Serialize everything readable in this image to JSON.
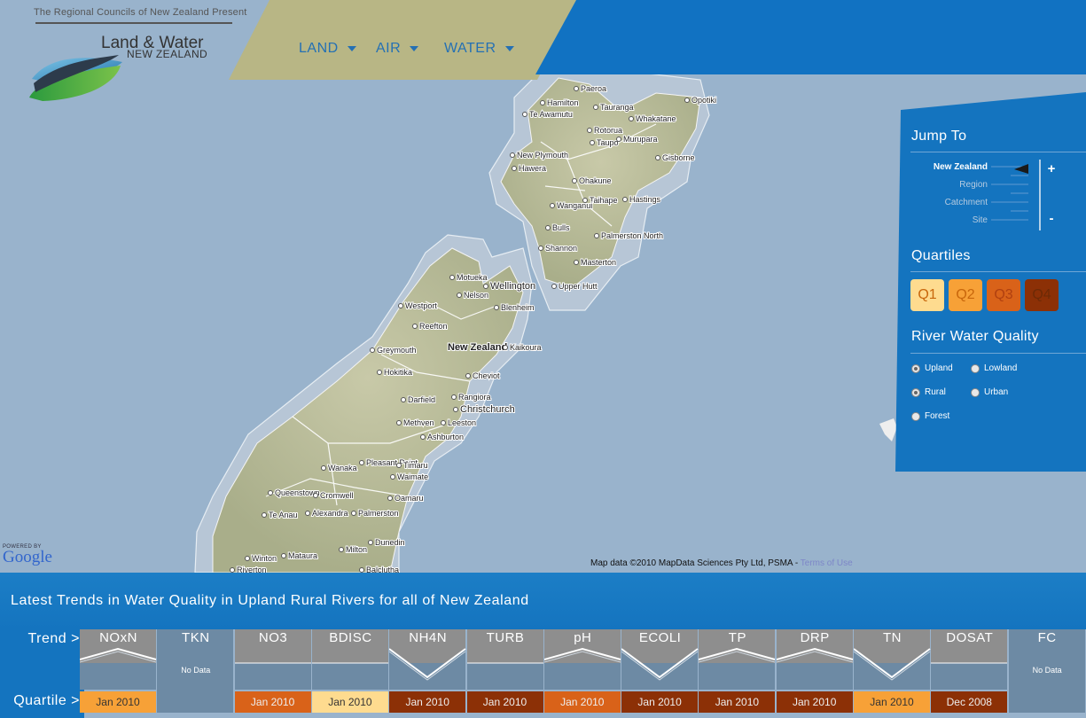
{
  "header": {
    "presenter": "The Regional Councils of New Zealand Present",
    "logo_line1": "Land & Water",
    "logo_line2": "NEW ZEALAND"
  },
  "nav": [
    {
      "label": "LAND"
    },
    {
      "label": "AIR"
    },
    {
      "label": "WATER"
    }
  ],
  "map": {
    "places": [
      "Paeroa",
      "Hamilton",
      "Te Awamutu",
      "Tauranga",
      "Whakatane",
      "Opotiki",
      "Rotorua",
      "Taupo",
      "Murupara",
      "Gisborne",
      "New Plymouth",
      "Hawera",
      "Ohakune",
      "Taihape",
      "Hastings",
      "Wanganui",
      "Bulls",
      "Palmerston North",
      "Shannon",
      "Masterton",
      "Upper Hutt",
      "Wellington",
      "Motueka",
      "Nelson",
      "Blenheim",
      "Westport",
      "Reefton",
      "New Zealand",
      "Kaikoura",
      "Greymouth",
      "Hokitika",
      "Cheviot",
      "Rangiora",
      "Darfield",
      "Christchurch",
      "Methven",
      "Leeston",
      "Ashburton",
      "Wanaka",
      "Pleasant Point",
      "Timaru",
      "Waimate",
      "Queenstown",
      "Cromwell",
      "Te Anau",
      "Alexandra",
      "Oamaru",
      "Palmerston",
      "Dunedin",
      "Winton",
      "Mataura",
      "Milton",
      "Riverton",
      "Balclutha"
    ],
    "powered_by": "POWERED BY",
    "google": "Google",
    "attribution": "Map data ©2010  MapData Sciences Pty Ltd, PSMA - ",
    "terms": "Terms of Use"
  },
  "jump_to": {
    "title": "Jump To",
    "levels": [
      "New Zealand",
      "Region",
      "Catchment",
      "Site"
    ],
    "zoom_in": "+",
    "zoom_out": "-"
  },
  "quartiles": {
    "title": "Quartiles",
    "items": [
      {
        "label": "Q1",
        "color": "#fedb8f",
        "text": "#c8660b"
      },
      {
        "label": "Q2",
        "color": "#f7a137",
        "text": "#c8660b"
      },
      {
        "label": "Q3",
        "color": "#d96219",
        "text": "#b04010"
      },
      {
        "label": "Q4",
        "color": "#8c3006",
        "text": "#6d2a06"
      }
    ]
  },
  "river_quality": {
    "title": "River Water Quality",
    "options": [
      {
        "label": "Upland",
        "selected": true
      },
      {
        "label": "Lowland",
        "selected": false
      },
      {
        "label": "Rural",
        "selected": true
      },
      {
        "label": "Urban",
        "selected": false
      },
      {
        "label": "Forest",
        "selected": false
      }
    ]
  },
  "trends": {
    "title": "Latest Trends in Water Quality in Upland Rural Rivers for all of New Zealand",
    "trend_label": "Trend >",
    "quartile_label": "Quartile >",
    "no_data": "No Data",
    "indicators": [
      {
        "name": "NOxN",
        "trend": "up",
        "date": "Jan 2010",
        "quartile": "Q2"
      },
      {
        "name": "TKN",
        "trend": "none",
        "date": "",
        "quartile": "none"
      },
      {
        "name": "NO3",
        "trend": "flat",
        "date": "Jan 2010",
        "quartile": "Q3"
      },
      {
        "name": "BDISC",
        "trend": "flat",
        "date": "Jan 2010",
        "quartile": "Q1"
      },
      {
        "name": "NH4N",
        "trend": "down",
        "date": "Jan 2010",
        "quartile": "Q4"
      },
      {
        "name": "TURB",
        "trend": "flat",
        "date": "Jan 2010",
        "quartile": "Q4"
      },
      {
        "name": "pH",
        "trend": "up",
        "date": "Jan 2010",
        "quartile": "Q3"
      },
      {
        "name": "ECOLI",
        "trend": "down",
        "date": "Jan 2010",
        "quartile": "Q4"
      },
      {
        "name": "TP",
        "trend": "up",
        "date": "Jan 2010",
        "quartile": "Q4"
      },
      {
        "name": "DRP",
        "trend": "up",
        "date": "Jan 2010",
        "quartile": "Q4"
      },
      {
        "name": "TN",
        "trend": "down",
        "date": "Jan 2010",
        "quartile": "Q2"
      },
      {
        "name": "DOSAT",
        "trend": "flat",
        "date": "Dec 2008",
        "quartile": "Q4"
      },
      {
        "name": "FC",
        "trend": "none",
        "date": "",
        "quartile": "none"
      }
    ]
  }
}
